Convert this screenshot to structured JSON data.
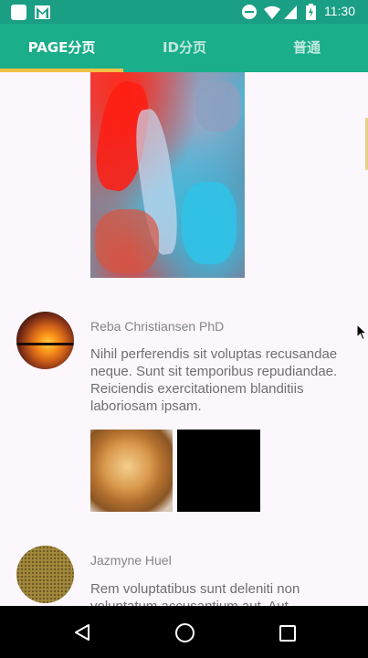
{
  "status_bar": {
    "time": "11:30",
    "icons": [
      "app-icon",
      "gmail-icon",
      "do-not-disturb-icon",
      "wifi-icon",
      "cellular-signal-icon",
      "battery-charging-icon"
    ]
  },
  "tabs": [
    {
      "label": "PAGE分页",
      "active": true
    },
    {
      "label": "ID分页",
      "active": false
    },
    {
      "label": "普通",
      "active": false
    }
  ],
  "feed": {
    "posts": [
      {
        "author": "Reba Christiansen PhD",
        "body": "Nihil perferendis sit voluptas recusandae neque. Sunt sit temporibus repudiandae. Reiciendis exercitationem blanditiis laboriosam ipsam.",
        "avatar": "sunset-photo",
        "images": [
          "bread-photo",
          "black-photo"
        ]
      },
      {
        "author": "Jazmyne Huel",
        "body": "Rem voluptatibus sunt deleniti non voluptatum accusantium aut. Aut",
        "avatar": "textured-photo"
      }
    ],
    "top_image": "abstract-painting-photo"
  },
  "nav_bar": {
    "buttons": [
      "back-icon",
      "home-icon",
      "recents-icon"
    ]
  },
  "colors": {
    "status_bar": "#1a9e84",
    "tab_bar": "#1aae8b",
    "tab_indicator": "#f0c244",
    "background": "#fbf7fc",
    "nav_bar": "#000000"
  }
}
